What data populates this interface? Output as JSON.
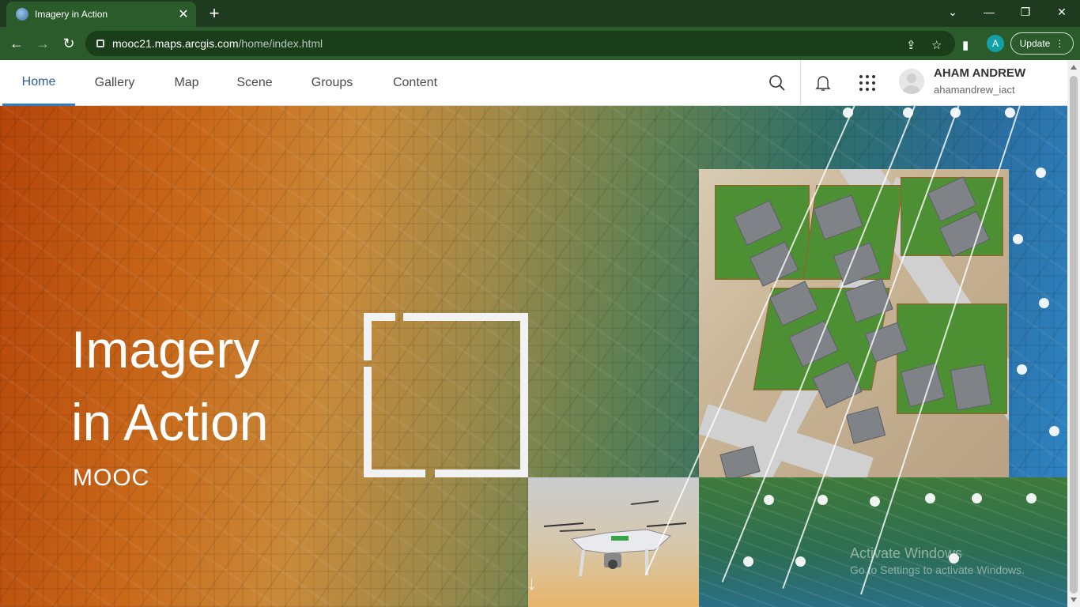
{
  "browser": {
    "tab_title": "Imagery in Action",
    "url_host": "mooc21.maps.arcgis.com",
    "url_path": "/home/index.html",
    "profile_initial": "A",
    "update_label": "Update",
    "accent": "#2b5a2b"
  },
  "nav": {
    "tabs": [
      {
        "label": "Home"
      },
      {
        "label": "Gallery"
      },
      {
        "label": "Map"
      },
      {
        "label": "Scene"
      },
      {
        "label": "Groups"
      },
      {
        "label": "Content"
      }
    ],
    "active_tab": "Home"
  },
  "user": {
    "name": "AHAM ANDREW",
    "handle": "ahamandrew_iact"
  },
  "hero": {
    "title_line1": "Imagery",
    "title_line2": "in Action",
    "subtitle": "MOOC",
    "watermark_line1": "Activate Windows",
    "watermark_line2": "Go to Settings to activate Windows."
  },
  "icons": [
    "search-icon",
    "bell-icon",
    "app-launcher-icon",
    "back-icon",
    "forward-icon",
    "reload-icon",
    "share-icon",
    "star-icon",
    "sidebar-icon"
  ]
}
